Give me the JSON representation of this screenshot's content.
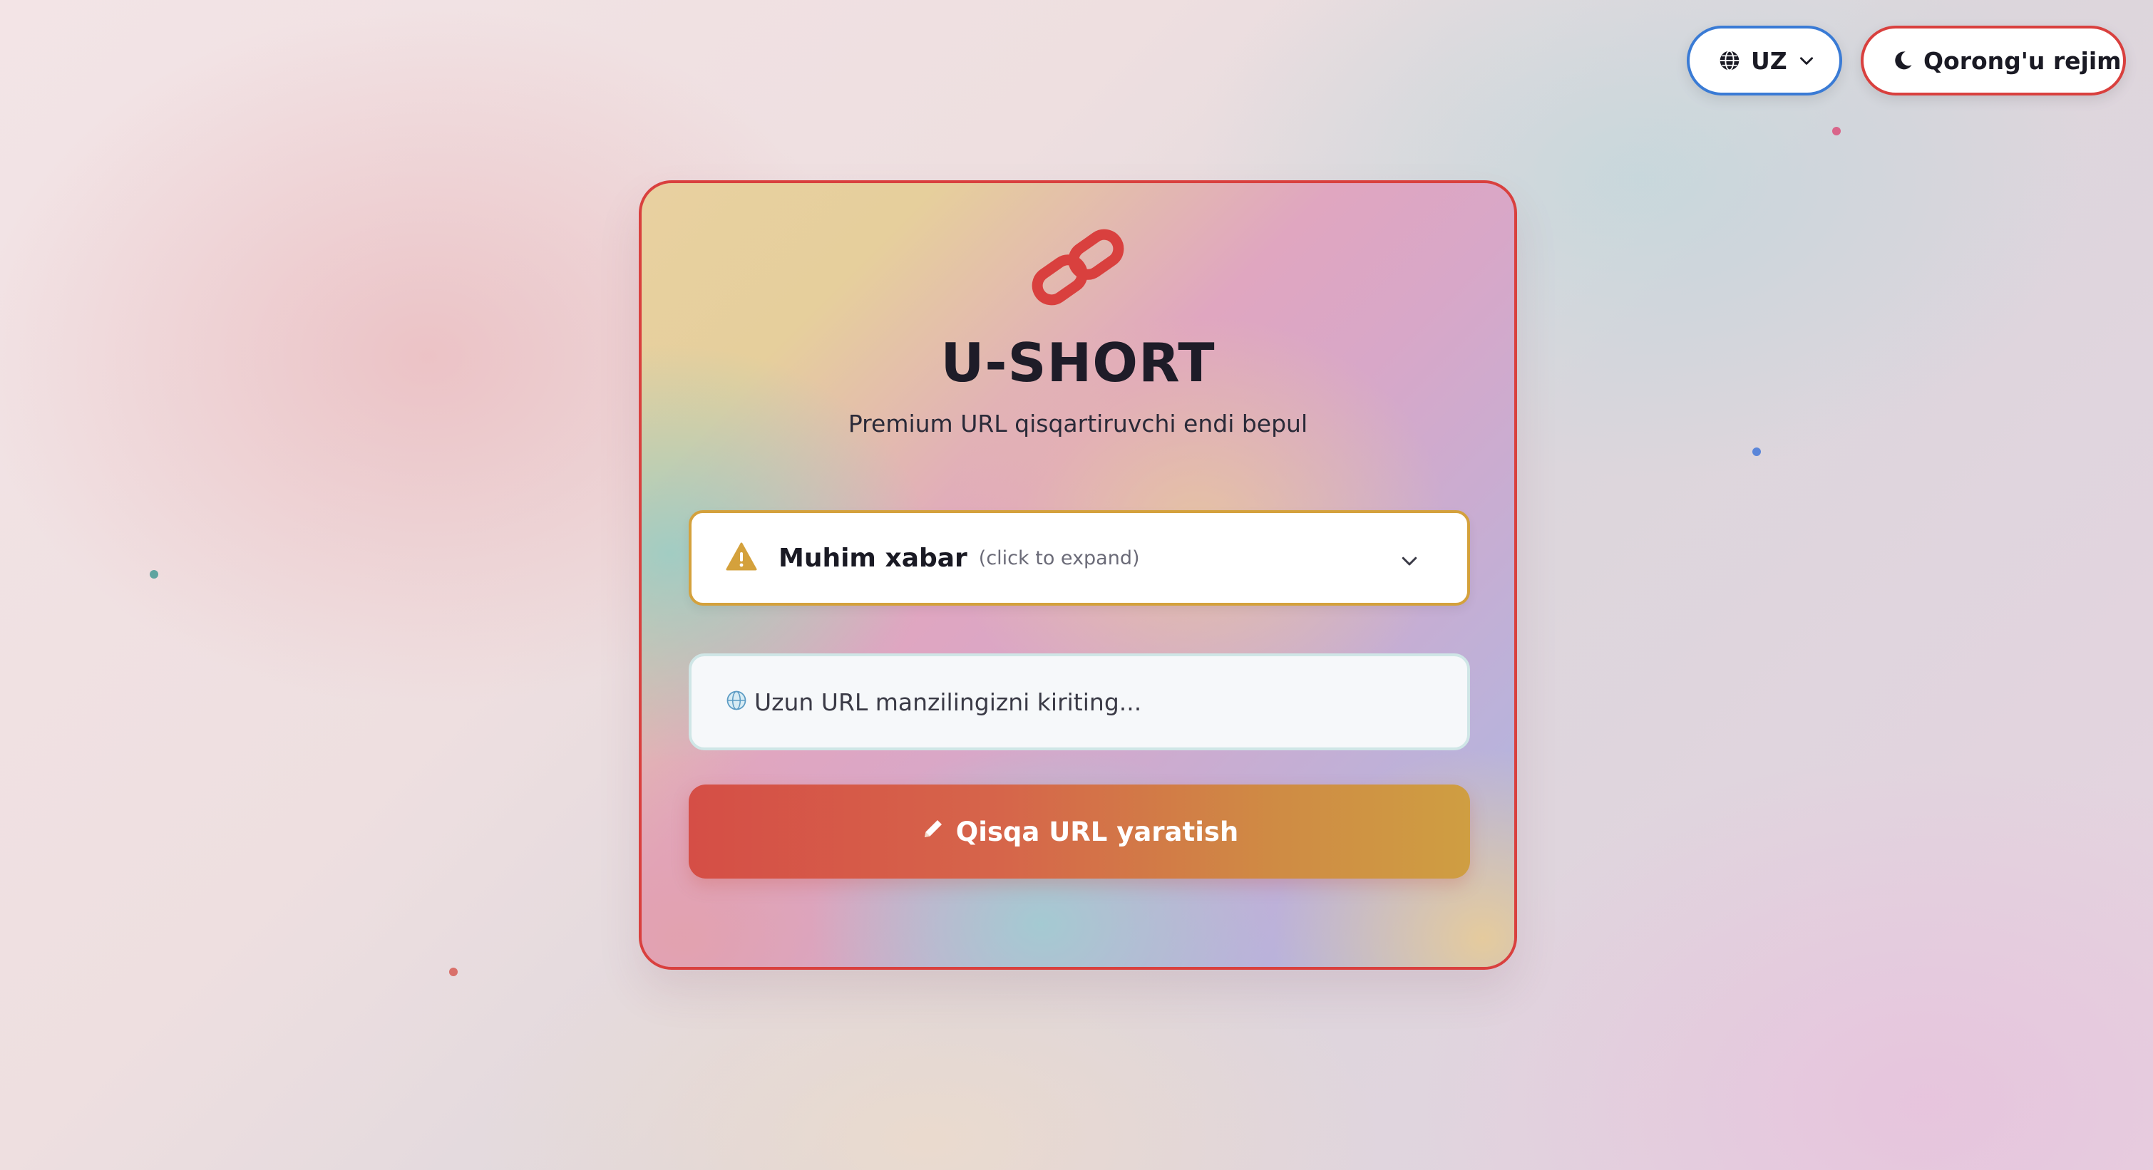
{
  "top_controls": {
    "language": {
      "label": "UZ"
    },
    "theme_toggle": {
      "label": "Qorong'u rejim"
    }
  },
  "card": {
    "app_title": "U-SHORT",
    "tagline": "Premium URL qisqartiruvchi endi bepul",
    "notice": {
      "title": "Muhim xabar",
      "hint": "(click to expand)"
    },
    "url_field": {
      "placeholder": "Uzun URL manzilingizni kiriting...",
      "value": ""
    },
    "submit_button": {
      "label": "Qisqa URL yaratish"
    }
  },
  "colors": {
    "accent_red": "#d9403e",
    "accent_blue": "#3a7bd5",
    "warning_gold": "#d4a13c",
    "button_gradient_start": "#d54e46",
    "button_gradient_end": "#cf9e42"
  },
  "icons": {
    "language": "globe-icon",
    "language_dropdown": "chevron-down-icon",
    "theme": "moon-icon",
    "logo": "link-icon",
    "notice": "warning-icon",
    "notice_expand": "chevron-down-icon",
    "url_field": "globe-icon",
    "submit": "pencil-icon"
  }
}
